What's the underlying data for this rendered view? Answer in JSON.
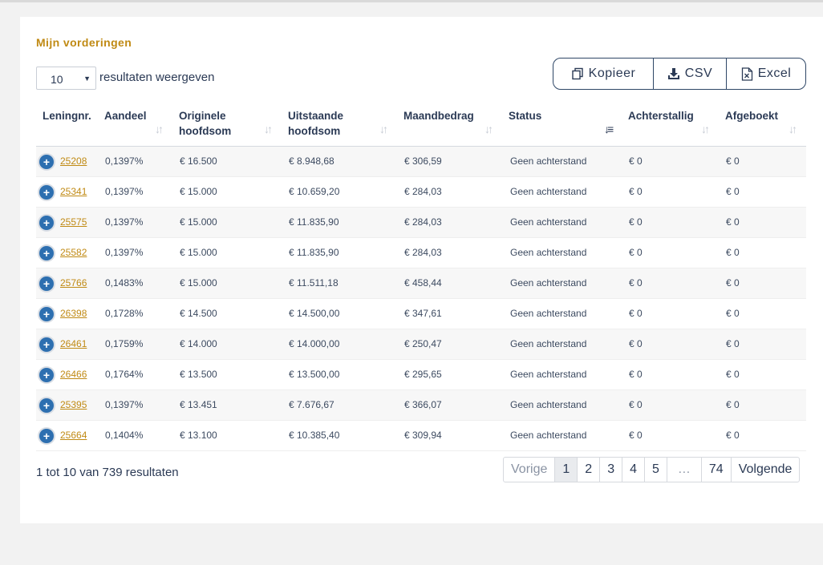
{
  "section_title": "Mijn vorderingen",
  "length_menu": {
    "value": "10",
    "label": "resultaten weergeven"
  },
  "export_buttons": [
    {
      "label": "Kopieer",
      "icon": "copy-icon"
    },
    {
      "label": "CSV",
      "icon": "download-icon"
    },
    {
      "label": "Excel",
      "icon": "excel-file-icon"
    }
  ],
  "columns": [
    {
      "label": "Leningnr.",
      "sortable": false
    },
    {
      "label": "Aandeel",
      "sortable": true
    },
    {
      "label": "Originele hoofdsom",
      "sortable": true
    },
    {
      "label": "Uitstaande hoofdsom",
      "sortable": true
    },
    {
      "label": "Maandbedrag",
      "sortable": true
    },
    {
      "label": "Status",
      "sortable": true,
      "active_sort": "descending"
    },
    {
      "label": "Achterstallig",
      "sortable": true
    },
    {
      "label": "Afgeboekt",
      "sortable": true
    }
  ],
  "rows": [
    {
      "loan": "25208",
      "share": "0,1397%",
      "original": "€ 16.500",
      "outstanding": "€ 8.948,68",
      "monthly": "€ 306,59",
      "status": "Geen achterstand",
      "arrears": "€ 0",
      "written_off": "€ 0"
    },
    {
      "loan": "25341",
      "share": "0,1397%",
      "original": "€ 15.000",
      "outstanding": "€ 10.659,20",
      "monthly": "€ 284,03",
      "status": "Geen achterstand",
      "arrears": "€ 0",
      "written_off": "€ 0"
    },
    {
      "loan": "25575",
      "share": "0,1397%",
      "original": "€ 15.000",
      "outstanding": "€ 11.835,90",
      "monthly": "€ 284,03",
      "status": "Geen achterstand",
      "arrears": "€ 0",
      "written_off": "€ 0"
    },
    {
      "loan": "25582",
      "share": "0,1397%",
      "original": "€ 15.000",
      "outstanding": "€ 11.835,90",
      "monthly": "€ 284,03",
      "status": "Geen achterstand",
      "arrears": "€ 0",
      "written_off": "€ 0"
    },
    {
      "loan": "25766",
      "share": "0,1483%",
      "original": "€ 15.000",
      "outstanding": "€ 11.511,18",
      "monthly": "€ 458,44",
      "status": "Geen achterstand",
      "arrears": "€ 0",
      "written_off": "€ 0"
    },
    {
      "loan": "26398",
      "share": "0,1728%",
      "original": "€ 14.500",
      "outstanding": "€ 14.500,00",
      "monthly": "€ 347,61",
      "status": "Geen achterstand",
      "arrears": "€ 0",
      "written_off": "€ 0"
    },
    {
      "loan": "26461",
      "share": "0,1759%",
      "original": "€ 14.000",
      "outstanding": "€ 14.000,00",
      "monthly": "€ 250,47",
      "status": "Geen achterstand",
      "arrears": "€ 0",
      "written_off": "€ 0"
    },
    {
      "loan": "26466",
      "share": "0,1764%",
      "original": "€ 13.500",
      "outstanding": "€ 13.500,00",
      "monthly": "€ 295,65",
      "status": "Geen achterstand",
      "arrears": "€ 0",
      "written_off": "€ 0"
    },
    {
      "loan": "25395",
      "share": "0,1397%",
      "original": "€ 13.451",
      "outstanding": "€ 7.676,67",
      "monthly": "€ 366,07",
      "status": "Geen achterstand",
      "arrears": "€ 0",
      "written_off": "€ 0"
    },
    {
      "loan": "25664",
      "share": "0,1404%",
      "original": "€ 13.100",
      "outstanding": "€ 10.385,40",
      "monthly": "€ 309,94",
      "status": "Geen achterstand",
      "arrears": "€ 0",
      "written_off": "€ 0"
    }
  ],
  "info": "1 tot 10 van 739 resultaten",
  "pagination": {
    "previous": "Vorige",
    "pages": [
      "1",
      "2",
      "3",
      "4",
      "5",
      "…",
      "74"
    ],
    "current": "1",
    "next": "Volgende"
  },
  "colors": {
    "accent": "#c08a14",
    "primary": "#2b3a55",
    "expand": "#2d6fb0"
  }
}
